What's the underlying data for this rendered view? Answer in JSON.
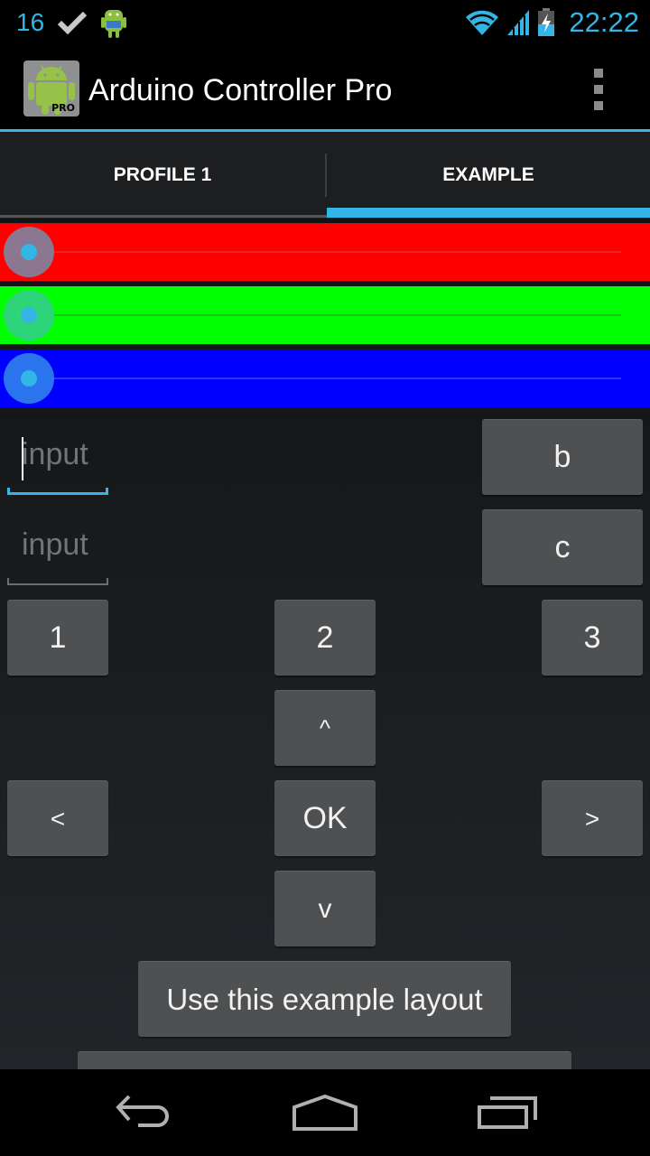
{
  "status_bar": {
    "notification_count": "16",
    "notification_icons": [
      "check-icon",
      "android-debug-icon"
    ],
    "status_icons": [
      "wifi-icon",
      "cell-signal-icon",
      "battery-charging-icon"
    ],
    "time": "22:22"
  },
  "action_bar": {
    "app_icon": "arduino-controller-pro-icon",
    "app_icon_badge": "PRO",
    "title": "Arduino Controller Pro",
    "overflow_icon": "overflow-menu-icon"
  },
  "tabs": [
    {
      "label": "PROFILE 1",
      "selected": false
    },
    {
      "label": "EXAMPLE",
      "selected": true
    }
  ],
  "accent_color": "#33b5e5",
  "sliders": [
    {
      "name": "red",
      "color": "#ff0000",
      "value": 0
    },
    {
      "name": "green",
      "color": "#00ff00",
      "value": 0
    },
    {
      "name": "blue",
      "color": "#0000ff",
      "value": 0
    }
  ],
  "inputs": [
    {
      "placeholder": "input",
      "value": "",
      "focused": true
    },
    {
      "placeholder": "input",
      "value": "",
      "focused": false
    }
  ],
  "buttons": {
    "b": "b",
    "c": "c",
    "one": "1",
    "two": "2",
    "three": "3",
    "up": "^",
    "left": "<",
    "ok": "OK",
    "right": ">",
    "down": "v",
    "use_layout": "Use this example layout"
  },
  "nav_bar": {
    "back": "back-icon",
    "home": "home-icon",
    "recents": "recent-apps-icon"
  }
}
